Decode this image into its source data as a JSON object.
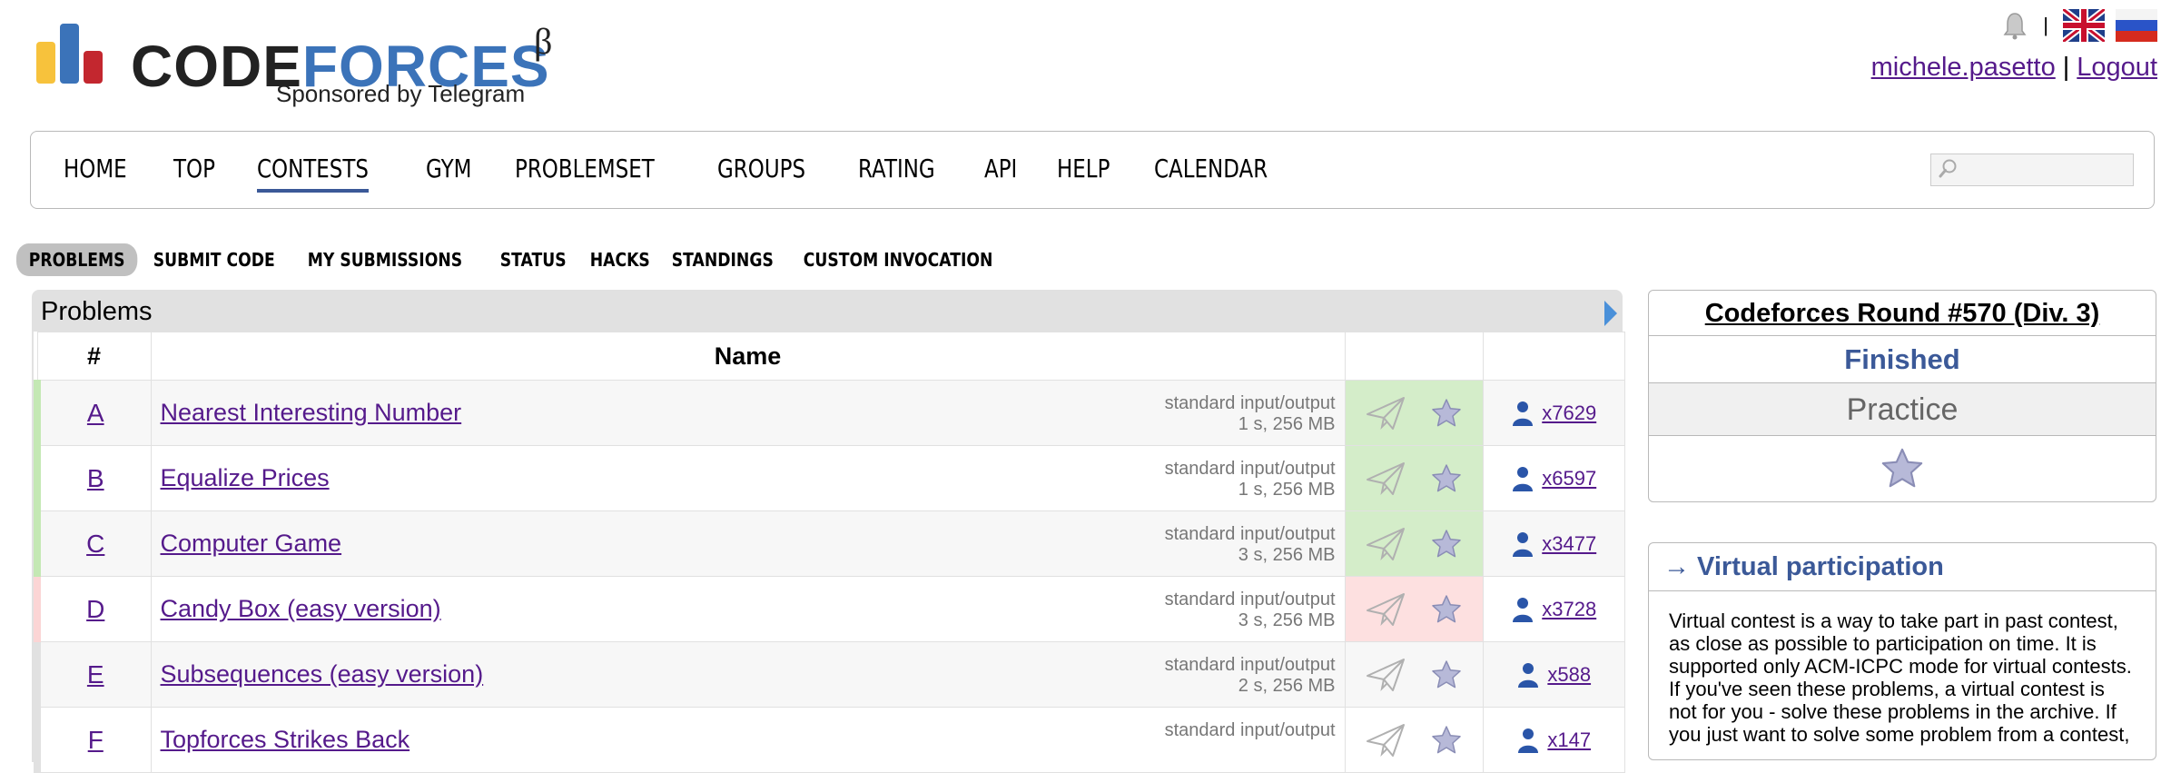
{
  "logo": {
    "word_code": "CODE",
    "word_forces": "FORCES",
    "beta": "β",
    "sponsor": "Sponsored by Telegram",
    "bar_colors": [
      "#f7c23c",
      "#3b73b9",
      "#c3272f"
    ]
  },
  "header": {
    "separator": "|",
    "username": "michele.pasetto",
    "logout": "Logout",
    "icons": [
      "bell-icon",
      "flag-uk-icon",
      "flag-ru-icon"
    ]
  },
  "mainnav": {
    "items": [
      "HOME",
      "TOP",
      "CONTESTS",
      "GYM",
      "PROBLEMSET",
      "GROUPS",
      "RATING",
      "API",
      "HELP",
      "CALENDAR"
    ],
    "active": "CONTESTS"
  },
  "submenu": {
    "items": [
      "PROBLEMS",
      "SUBMIT CODE",
      "MY SUBMISSIONS",
      "STATUS",
      "HACKS",
      "STANDINGS",
      "CUSTOM INVOCATION"
    ],
    "active": "PROBLEMS"
  },
  "problems": {
    "title": "Problems",
    "col_index": "#",
    "col_name": "Name",
    "rows": [
      {
        "index": "A",
        "name": "Nearest Interesting Number",
        "io": "standard input/output",
        "limits": "1 s, 256 MB",
        "solved": "x7629",
        "status": "ok"
      },
      {
        "index": "B",
        "name": "Equalize Prices",
        "io": "standard input/output",
        "limits": "1 s, 256 MB",
        "solved": "x6597",
        "status": "ok"
      },
      {
        "index": "C",
        "name": "Computer Game",
        "io": "standard input/output",
        "limits": "3 s, 256 MB",
        "solved": "x3477",
        "status": "ok"
      },
      {
        "index": "D",
        "name": "Candy Box (easy version)",
        "io": "standard input/output",
        "limits": "3 s, 256 MB",
        "solved": "x3728",
        "status": "bad"
      },
      {
        "index": "E",
        "name": "Subsequences (easy version)",
        "io": "standard input/output",
        "limits": "2 s, 256 MB",
        "solved": "x588",
        "status": "none"
      },
      {
        "index": "F",
        "name": "Topforces Strikes Back",
        "io": "standard input/output",
        "limits": "",
        "solved": "x147",
        "status": "none"
      }
    ]
  },
  "contest_box": {
    "name": "Codeforces Round #570 (Div. 3)",
    "state": "Finished",
    "mode": "Practice"
  },
  "virtual": {
    "title": "→ Virtual participation",
    "text": "Virtual contest is a way to take part in past contest, as close as possible to participation on time. It is supported only ACM-ICPC mode for virtual contests. If you've seen these problems, a virtual contest is not for you - solve these problems in the archive. If you just want to solve some problem from a contest,"
  },
  "colors": {
    "accent": "#3b5998",
    "ok_bg": "#d4edc9",
    "bad_bg": "#fde0e0",
    "link": "#551a8b"
  }
}
